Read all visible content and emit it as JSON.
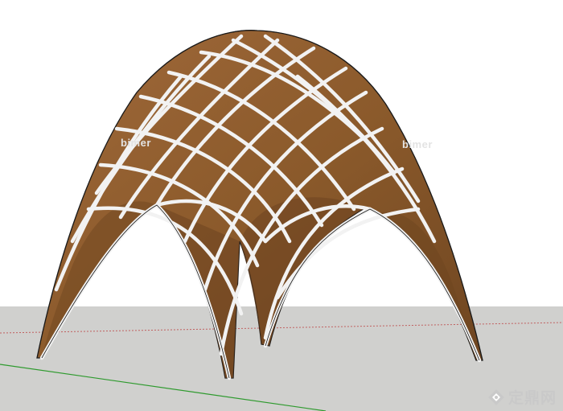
{
  "scene": {
    "sky_color": "#ffffff",
    "ground_color": "#d0d0ce",
    "wood_color": "#8b5a2b",
    "wood_shade": "#6d4420",
    "frame_color": "#f2f2f2",
    "edge_color": "#1a1a1a",
    "axis_green": "#2e9a2e",
    "axis_red": "#c06060"
  },
  "watermarks": {
    "left": "bimer",
    "right": "bimer"
  },
  "brand": {
    "logo_icon": "zhulong-diamond-logo",
    "label": "定鼎网"
  }
}
